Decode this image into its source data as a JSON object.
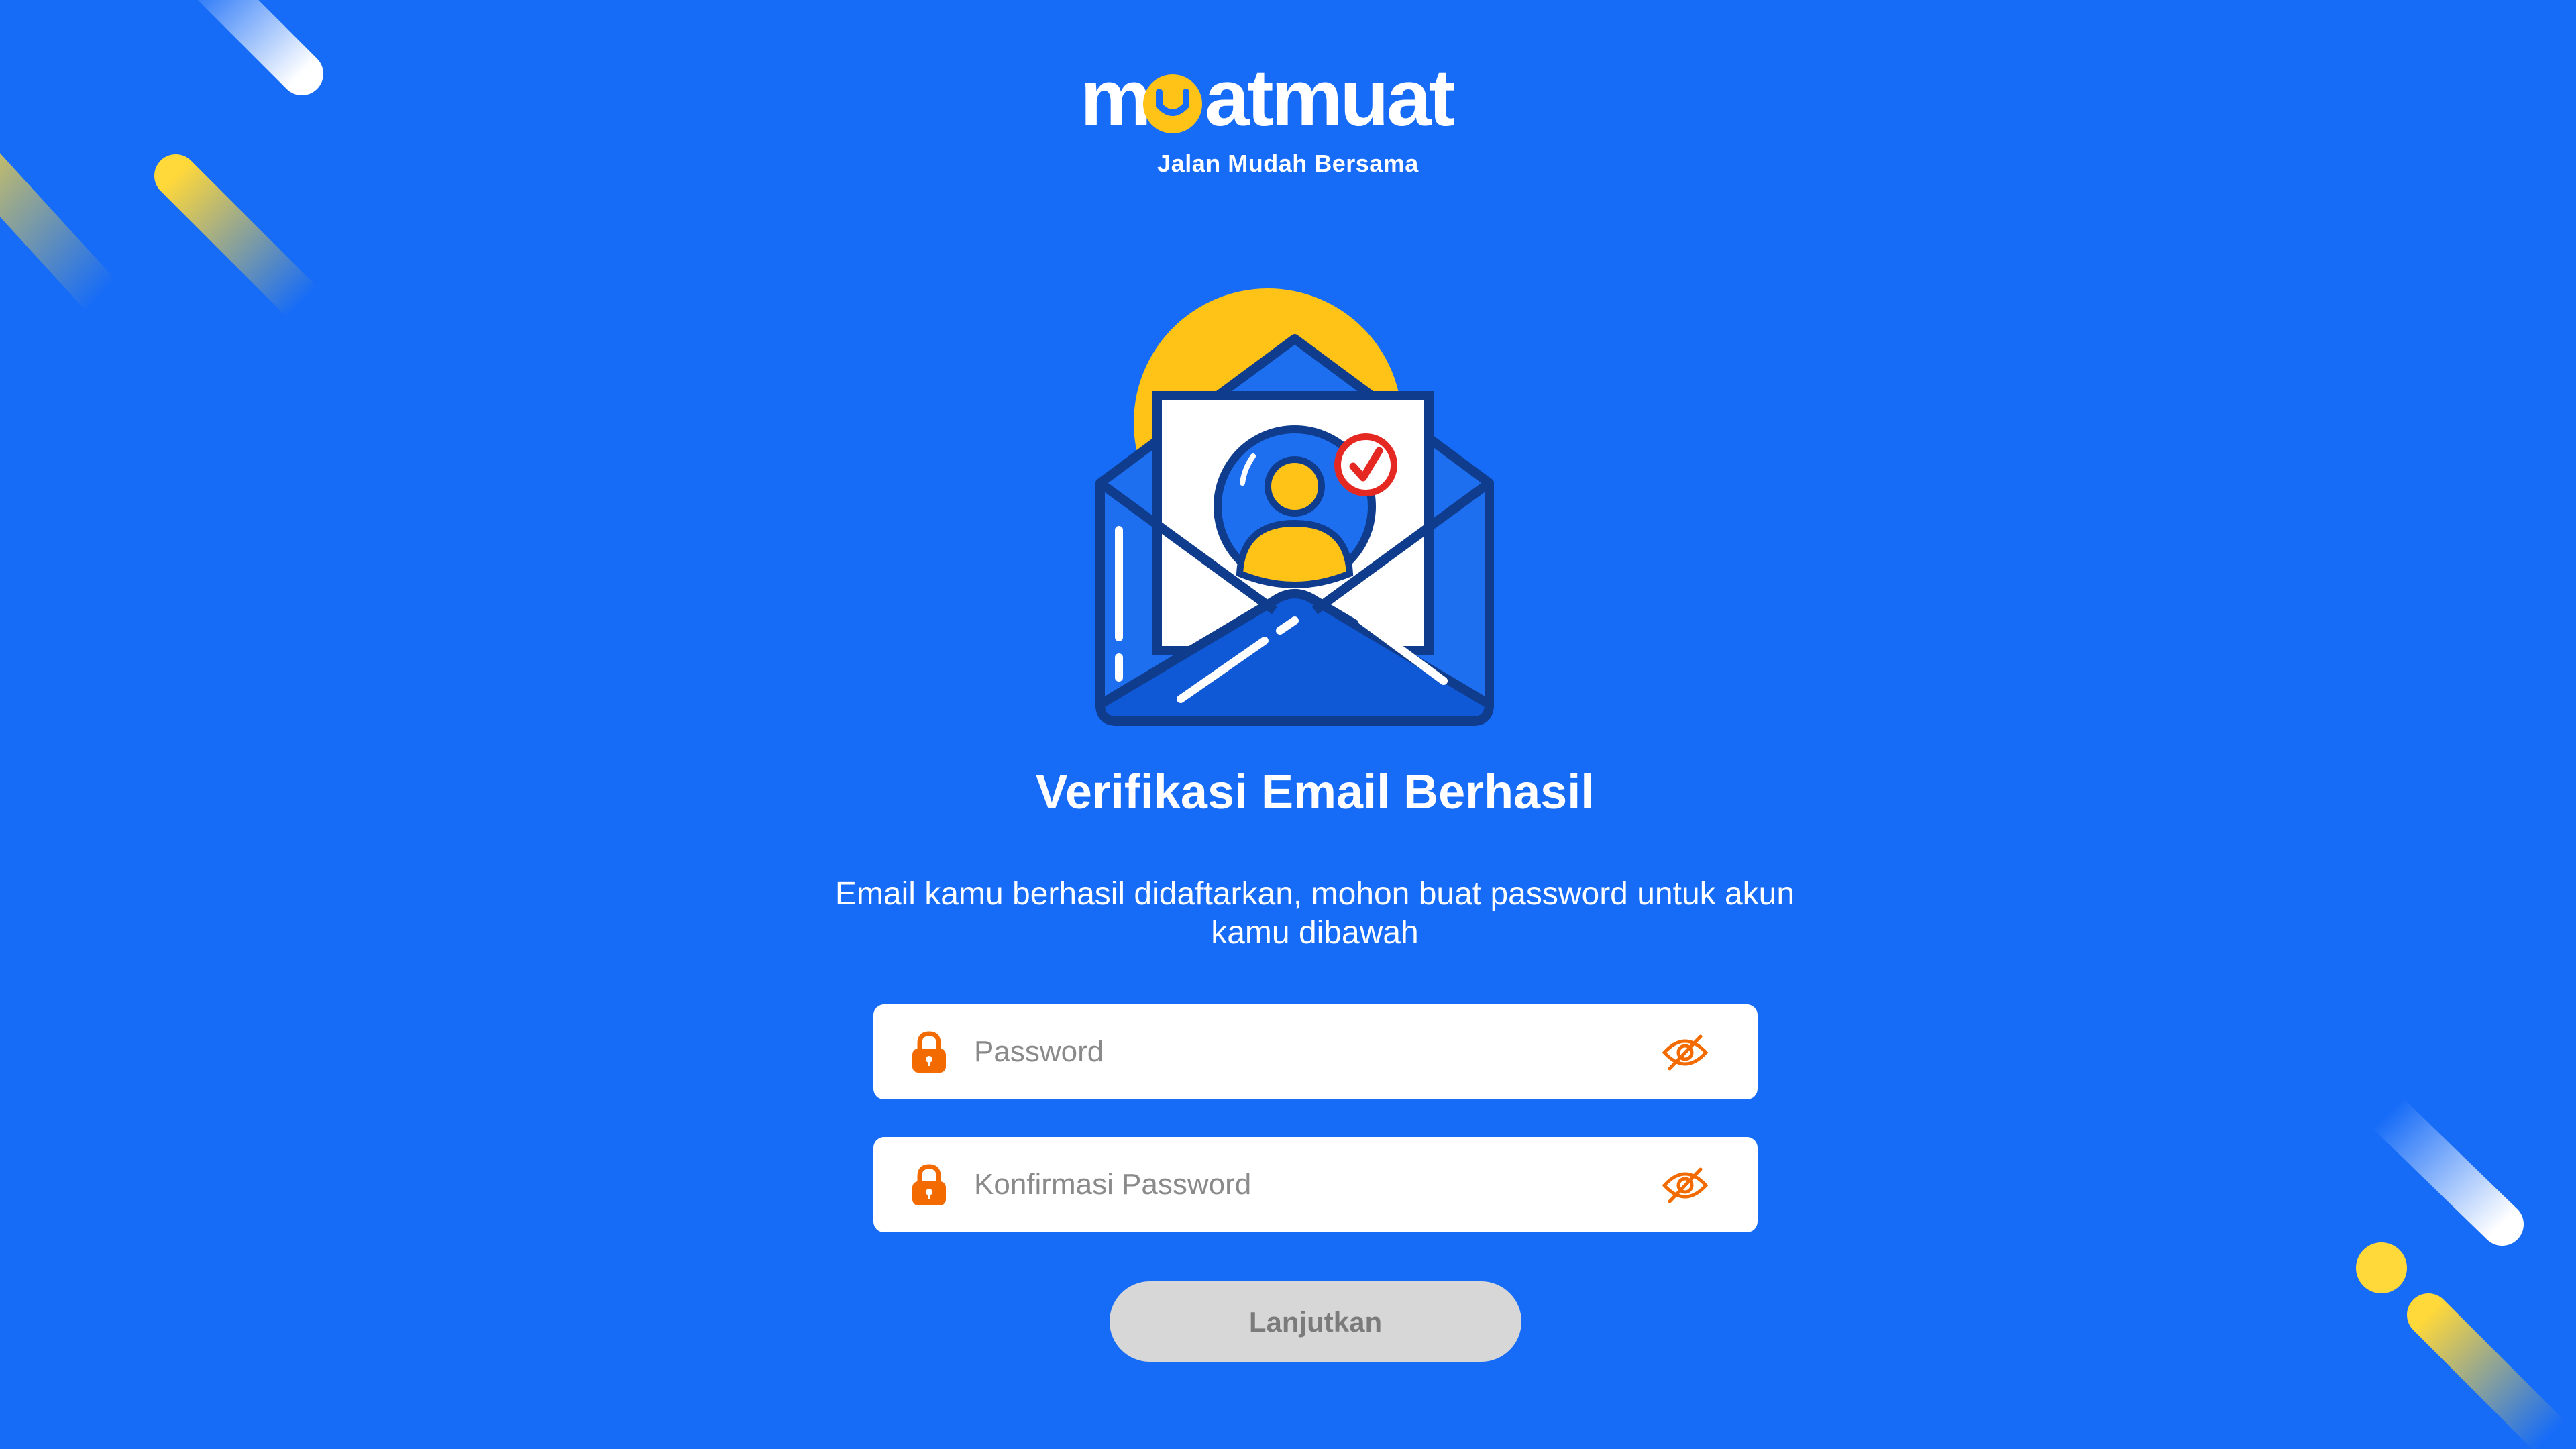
{
  "brand": {
    "name": "muatmuat",
    "tagline": "Jalan Mudah Bersama",
    "primary_color": "#176CF7",
    "accent_color": "#FFC217"
  },
  "verification": {
    "title": "Verifikasi Email Berhasil",
    "message": "Email kamu berhasil didaftarkan, mohon buat password untuk akun kamu dibawah"
  },
  "form": {
    "password": {
      "placeholder": "Password",
      "value": "",
      "icon": "lock-icon",
      "toggle_icon": "eye-slash-icon"
    },
    "confirm_password": {
      "placeholder": "Konfirmasi Password",
      "value": "",
      "icon": "lock-icon",
      "toggle_icon": "eye-slash-icon"
    },
    "submit_label": "Lanjutkan",
    "icon_color": "#F36B00",
    "submit_disabled_color": "#D7D7D7"
  },
  "illustration": {
    "icon": "email-verified-icon"
  }
}
